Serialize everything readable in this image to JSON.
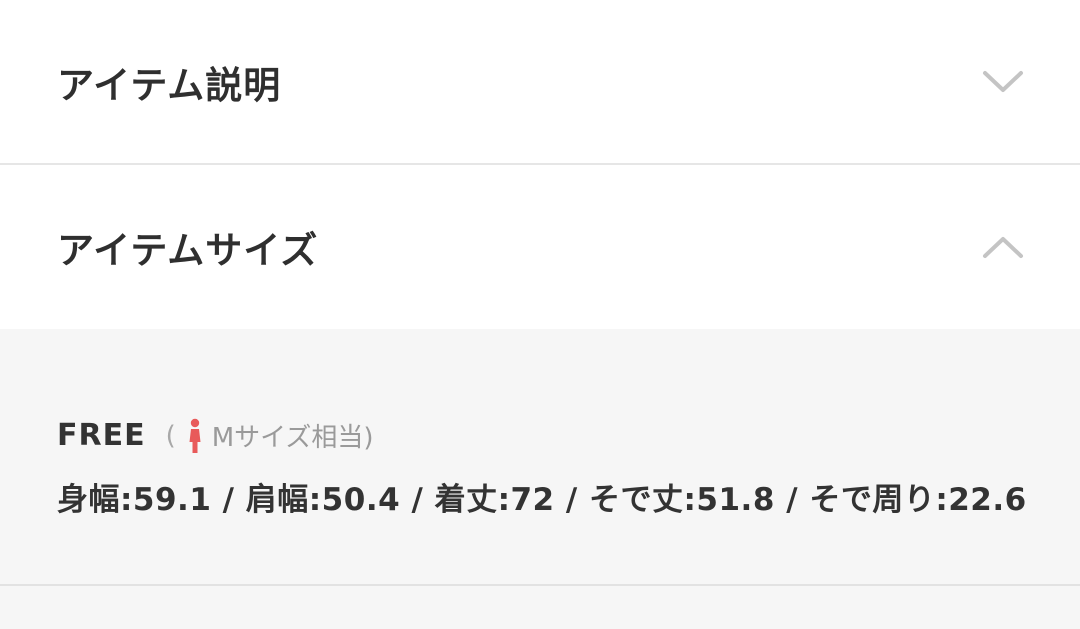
{
  "sections": {
    "description": {
      "title": "アイテム説明",
      "state": "collapsed",
      "icon": "chevron-down-icon"
    },
    "size": {
      "title": "アイテムサイズ",
      "state": "expanded",
      "icon": "chevron-up-icon",
      "size_label": "FREE",
      "note_open": "(",
      "note_text": "Mサイズ相当)",
      "note_icon": "female-person-icon",
      "measurements": "身幅:59.1 / 肩幅:50.4 / 着丈:72 / そで丈:51.8 / そで周り:22.6"
    }
  },
  "colors": {
    "accent_icon": "#e85a5a",
    "chevron": "#c4c4c4",
    "panel_bg": "#f6f6f6",
    "text": "#333333"
  }
}
